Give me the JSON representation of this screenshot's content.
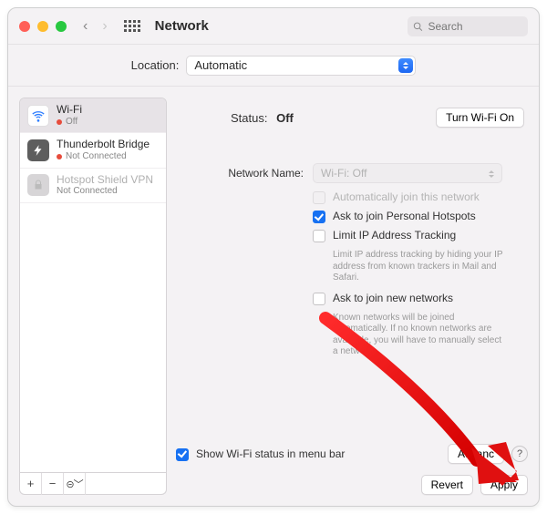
{
  "titlebar": {
    "title": "Network",
    "search_placeholder": "Search"
  },
  "location": {
    "label": "Location:",
    "value": "Automatic"
  },
  "sidebar": {
    "items": [
      {
        "name": "Wi-Fi",
        "status": "Off",
        "dot": "red",
        "selected": true,
        "disabled": false
      },
      {
        "name": "Thunderbolt Bridge",
        "status": "Not Connected",
        "dot": "red",
        "selected": false,
        "disabled": false
      },
      {
        "name": "Hotspot Shield VPN",
        "status": "Not Connected",
        "dot": "",
        "selected": false,
        "disabled": true
      }
    ]
  },
  "status": {
    "label": "Status:",
    "value": "Off",
    "toggle_button": "Turn Wi-Fi On"
  },
  "network_name": {
    "label": "Network Name:",
    "value": "Wi-Fi: Off"
  },
  "checkboxes": {
    "auto_join": {
      "label": "Automatically join this network",
      "checked": false,
      "disabled": true
    },
    "personal_hotspots": {
      "label": "Ask to join Personal Hotspots",
      "checked": true,
      "disabled": false
    },
    "limit_ip": {
      "label": "Limit IP Address Tracking",
      "checked": false,
      "help": "Limit IP address tracking by hiding your IP address from known trackers in Mail and Safari."
    },
    "ask_new": {
      "label": "Ask to join new networks",
      "checked": false,
      "help": "Known networks will be joined automatically. If no known networks are available, you will have to manually select a network."
    },
    "menubar": {
      "label": "Show Wi-Fi status in menu bar",
      "checked": true
    }
  },
  "buttons": {
    "advanced": "Advanc",
    "revert": "Revert",
    "apply": "Apply"
  }
}
